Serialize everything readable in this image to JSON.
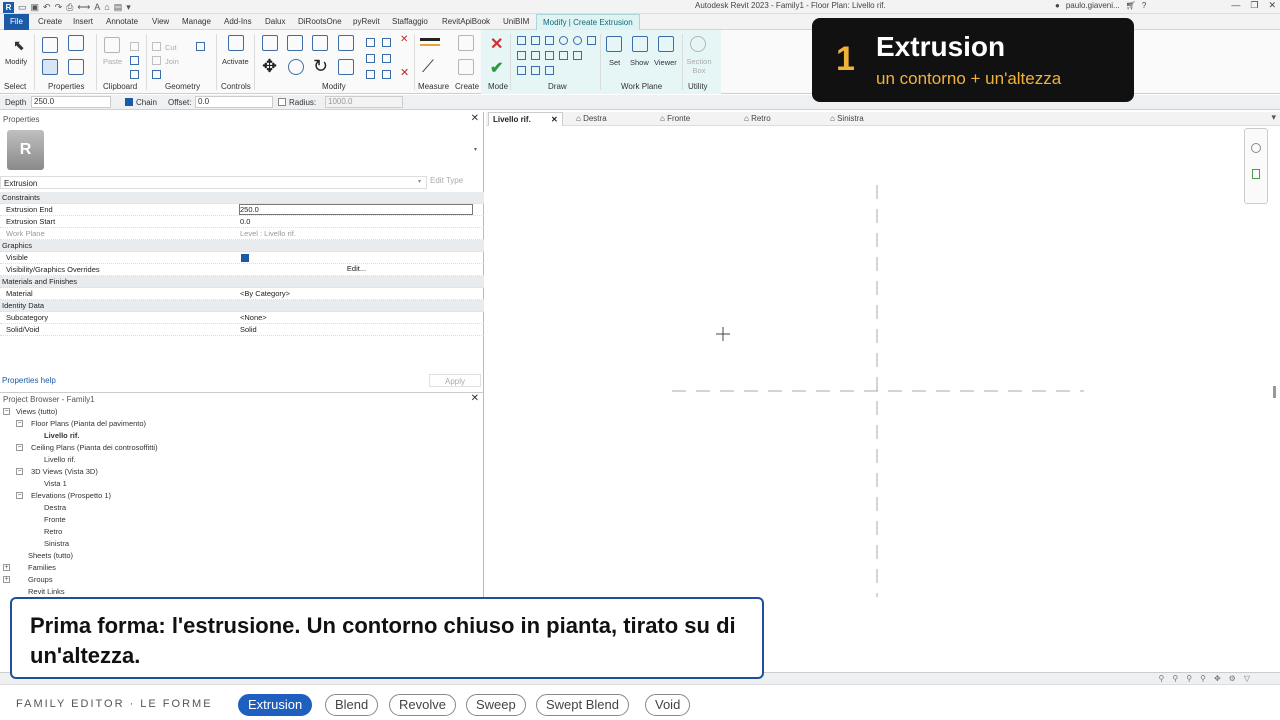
{
  "titlebar": {
    "title": "Autodesk Revit 2023 - Family1 - Floor Plan: Livello rif.",
    "user": "paulo.giaveni..."
  },
  "tabs": [
    "File",
    "Create",
    "Insert",
    "Annotate",
    "View",
    "Manage",
    "Add-Ins",
    "Dalux",
    "DiRootsOne",
    "pyRevit",
    "Staffaggio",
    "RevitApiBook",
    "UniBIM",
    "Modify | Create Extrusion"
  ],
  "ribbon": {
    "modify": "Modify",
    "paste": "Paste",
    "cut": "Cut",
    "join": "Join",
    "activate": "Activate",
    "set": "Set",
    "show": "Show",
    "viewer": "Viewer",
    "section_box": "Section Box",
    "groups": [
      "Select",
      "Properties",
      "Clipboard",
      "Geometry",
      "Controls",
      "Modify",
      "Measure",
      "Create",
      "Mode",
      "Draw",
      "Work Plane",
      "Utility"
    ]
  },
  "optionsbar": {
    "depth_label": "Depth",
    "depth_value": "250.0",
    "chain_label": "Chain",
    "offset_label": "Offset:",
    "offset_value": "0.0",
    "radius_label": "Radius:",
    "radius_value": "1000.0"
  },
  "properties": {
    "title": "Properties",
    "type_icon": "R",
    "type_selector": "Extrusion",
    "edit_type": "Edit Type",
    "sections": {
      "constraints": "Constraints",
      "graphics": "Graphics",
      "materials": "Materials and Finishes",
      "identity": "Identity Data"
    },
    "rows": {
      "extrusion_end": {
        "k": "Extrusion End",
        "v": "250.0"
      },
      "extrusion_start": {
        "k": "Extrusion Start",
        "v": "0.0"
      },
      "work_plane": {
        "k": "Work Plane",
        "v": "Level : Livello rif."
      },
      "visible": {
        "k": "Visible"
      },
      "vg_overrides": {
        "k": "Visibility/Graphics Overrides",
        "v": "Edit..."
      },
      "material": {
        "k": "Material",
        "v": "<By Category>"
      },
      "subcategory": {
        "k": "Subcategory",
        "v": "<None>"
      },
      "solid_void": {
        "k": "Solid/Void",
        "v": "Solid"
      }
    },
    "help": "Properties help",
    "apply": "Apply"
  },
  "browser": {
    "title": "Project Browser - Family1",
    "nodes": [
      "Views (tutto)",
      "Floor Plans (Pianta del pavimento)",
      "Livello rif.",
      "Ceiling Plans (Pianta dei controsoffitti)",
      "Livello rif.",
      "3D Views (Vista 3D)",
      "Vista 1",
      "Elevations (Prospetto 1)",
      "Destra",
      "Fronte",
      "Retro",
      "Sinistra",
      "Sheets (tutto)",
      "Families",
      "Groups",
      "Revit Links"
    ]
  },
  "viewtabs": [
    "Livello rif.",
    "Destra",
    "Fronte",
    "Retro",
    "Sinistra"
  ],
  "card": {
    "number": "1",
    "title": "Extrusion",
    "subtitle": "un contorno + un'altezza"
  },
  "caption": "Prima forma: l'estrusione. Un contorno chiuso in pianta, tirato su di un'altezza.",
  "strip": {
    "label": "FAMILY EDITOR · LE FORME",
    "pills": [
      "Extrusion",
      "Blend",
      "Revolve",
      "Sweep",
      "Swept Blend",
      "Void"
    ],
    "active": "Extrusion"
  },
  "colors": {
    "accent": "#f0b33a",
    "brand": "#1f5fbf",
    "context_tab": "#dff3f4"
  }
}
